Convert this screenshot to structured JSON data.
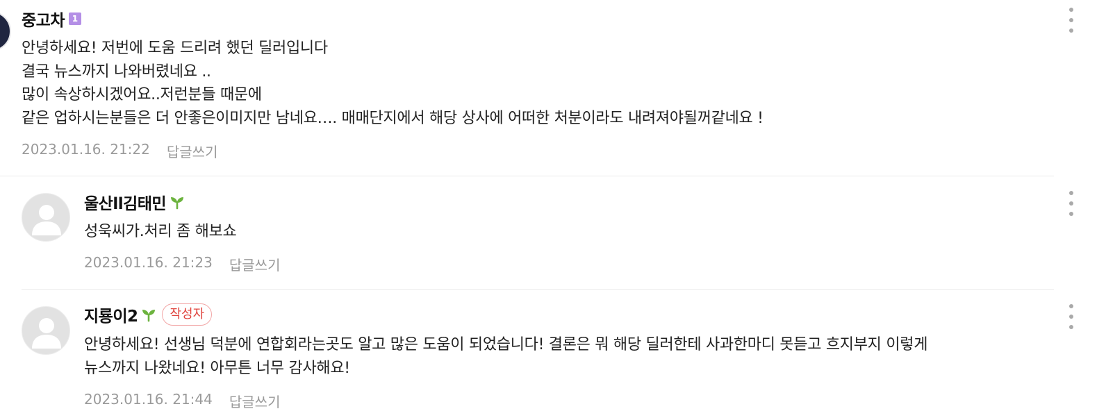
{
  "comments": [
    {
      "nickname": "중고차",
      "level_badge": "1",
      "text": "안녕하세요! 저번에 도움 드리려 했던 딜러입니다\n결국 뉴스까지 나와버렸네요 ..\n많이 속상하시겠어요..저런분들 때문에\n같은 업하시는분들은 더 안좋은이미지만 남네요…. 매매단지에서 해당 상사에 어떠한 처분이라도 내려져야될꺼같네요 !",
      "date": "2023.01.16. 21:22",
      "reply_label": "답글쓰기"
    },
    {
      "nickname": "울산ll김태민",
      "badge_icon": "sprout-icon",
      "text": "성욱씨가.처리 좀 해보쇼",
      "date": "2023.01.16. 21:23",
      "reply_label": "답글쓰기"
    },
    {
      "nickname": "지룡이2",
      "badge_icon": "sprout-icon",
      "author_badge": "작성자",
      "text": "안녕하세요! 선생님 덕분에 연합회라는곳도 알고 많은 도움이 되었습니다! 결론은 뭐 해당 딜러한테 사과한마디 못듣고 흐지부지 이렇게\n뉴스까지 나왔네요! 아무튼 너무 감사해요!",
      "date": "2023.01.16. 21:44",
      "reply_label": "답글쓰기"
    }
  ],
  "colors": {
    "level_badge": "#b48fe6",
    "sprout": "#6cb33e",
    "author_badge": "#e0453f",
    "meta_text": "#9a9a9a"
  }
}
